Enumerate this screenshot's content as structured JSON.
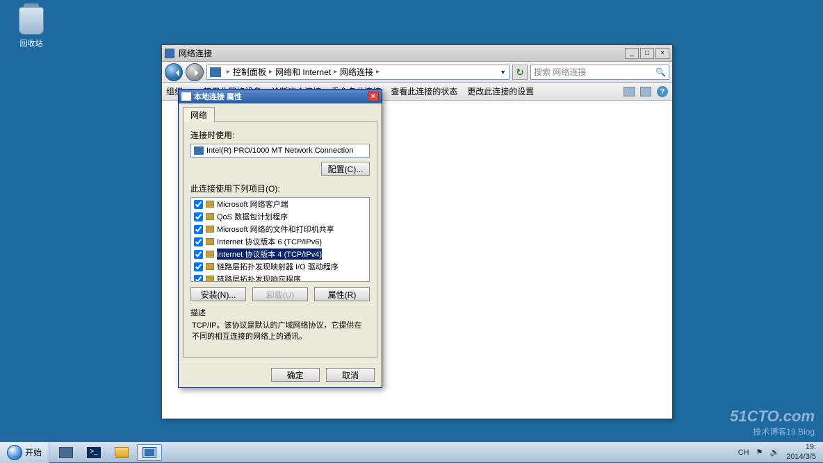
{
  "desktop": {
    "recycle_bin": "回收站"
  },
  "explorer": {
    "title": "网络连接",
    "breadcrumb": [
      "控制面板",
      "网络和 Internet",
      "网络连接"
    ],
    "search_placeholder": "搜索 网络连接",
    "toolbar": {
      "organize": "组织 ▼",
      "disable": "禁用此网络设备",
      "diagnose": "诊断这个连接",
      "rename": "重命名此连接",
      "status": "查看此连接的状态",
      "settings": "更改此连接的设置"
    }
  },
  "dialog": {
    "title": "本地连接 属性",
    "tab": "网络",
    "connect_using": "连接时使用:",
    "adapter": "Intel(R) PRO/1000 MT Network Connection",
    "configure": "配置(C)...",
    "items_label": "此连接使用下列项目(O):",
    "items": [
      {
        "checked": true,
        "label": "Microsoft 网络客户端"
      },
      {
        "checked": true,
        "label": "QoS 数据包计划程序"
      },
      {
        "checked": true,
        "label": "Microsoft 网络的文件和打印机共享"
      },
      {
        "checked": true,
        "label": "Internet 协议版本 6 (TCP/IPv6)"
      },
      {
        "checked": true,
        "label": "Internet 协议版本 4 (TCP/IPv4)",
        "selected": true
      },
      {
        "checked": true,
        "label": "链路层拓扑发现映射器 I/O 驱动程序"
      },
      {
        "checked": true,
        "label": "链路层拓扑发现响应程序"
      }
    ],
    "install": "安装(N)...",
    "uninstall": "卸载(U)",
    "properties": "属性(R)",
    "desc_label": "描述",
    "desc_text": "TCP/IP。该协议是默认的广域网络协议，它提供在不同的相互连接的网络上的通讯。",
    "ok": "确定",
    "cancel": "取消"
  },
  "taskbar": {
    "start": "开始",
    "lang": "CH",
    "time": "19:",
    "date": "2014/3/5"
  },
  "watermark": {
    "line1": "51CTO.com",
    "line2": "技术博客19.Blog"
  }
}
